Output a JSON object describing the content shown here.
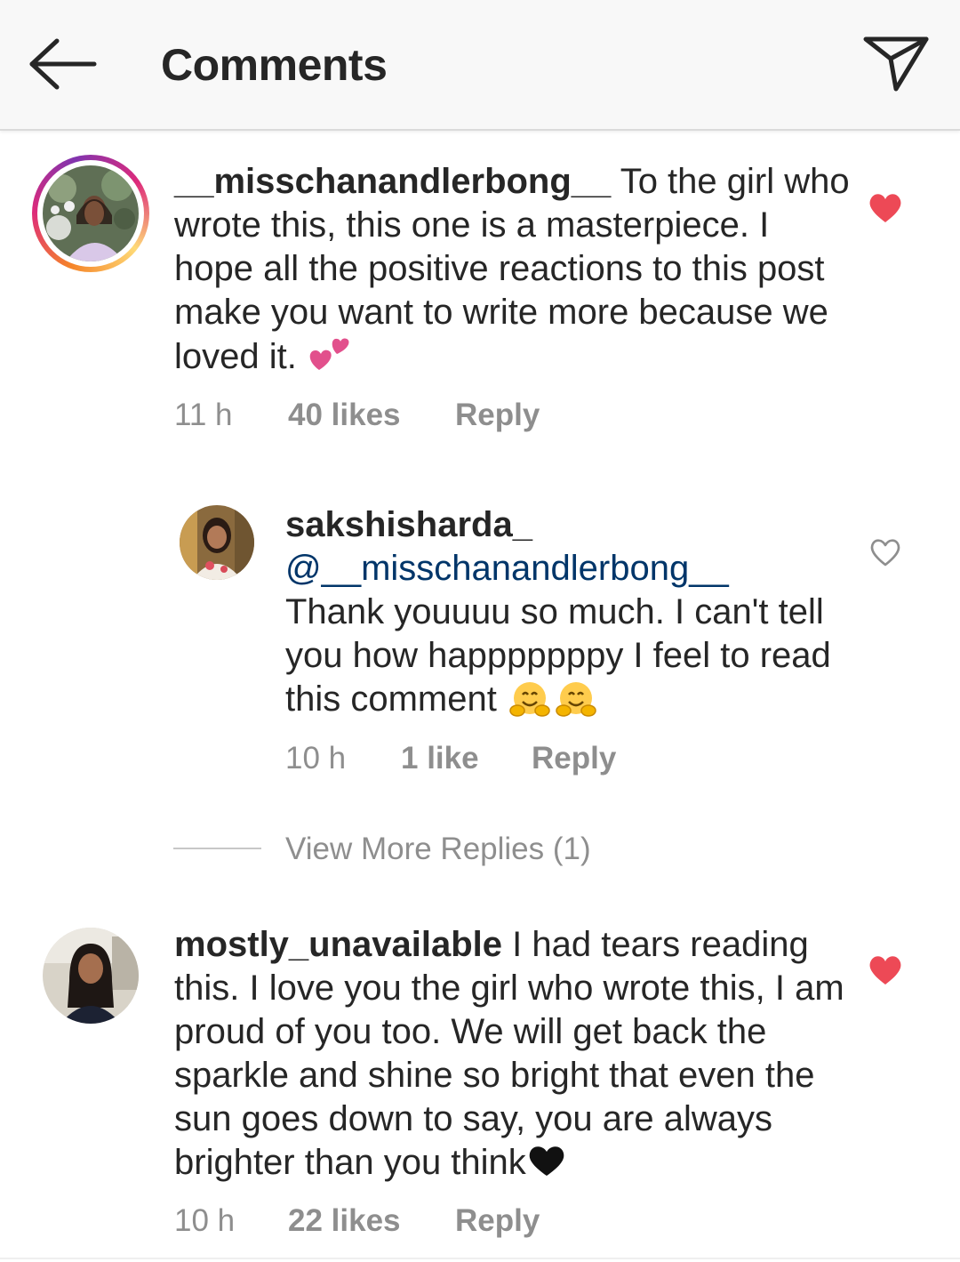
{
  "header": {
    "title": "Comments",
    "back_icon": "arrow-left-icon",
    "send_icon": "paper-plane-icon"
  },
  "comments": [
    {
      "username": "__misschanandlerbong__",
      "text": " To the girl who wrote this, this one is a masterpiece. I hope all the positive reactions to this post make you want to write more because we loved it.",
      "emoji": "💕",
      "time": "11 h",
      "likes": "40 likes",
      "reply": "Reply",
      "liked": true,
      "has_story_ring": true
    },
    {
      "username": "mostly_unavailable",
      "text": " I had tears reading this. I love you the girl who wrote this, I am proud of you too. We will get back the sparkle and shine so bright that even the sun goes down to say, you are always brighter than you think",
      "emoji": "❤",
      "time": "10 h",
      "likes": "22 likes",
      "reply": "Reply",
      "liked": true,
      "has_story_ring": false
    }
  ],
  "reply": {
    "username": "sakshisharda_",
    "mention": "@__misschanandlerbong__",
    "text": "Thank youuuu so much. I can't tell you how happpppppy I feel to read this comment",
    "emoji": "🤗🤗",
    "time": "10 h",
    "likes": "1 like",
    "reply": "Reply",
    "liked": false
  },
  "view_more_replies": "View More Replies (1)",
  "colors": {
    "heart_liked": "#ed4956",
    "muted_text": "#8e8e8e",
    "mention": "#003569"
  }
}
